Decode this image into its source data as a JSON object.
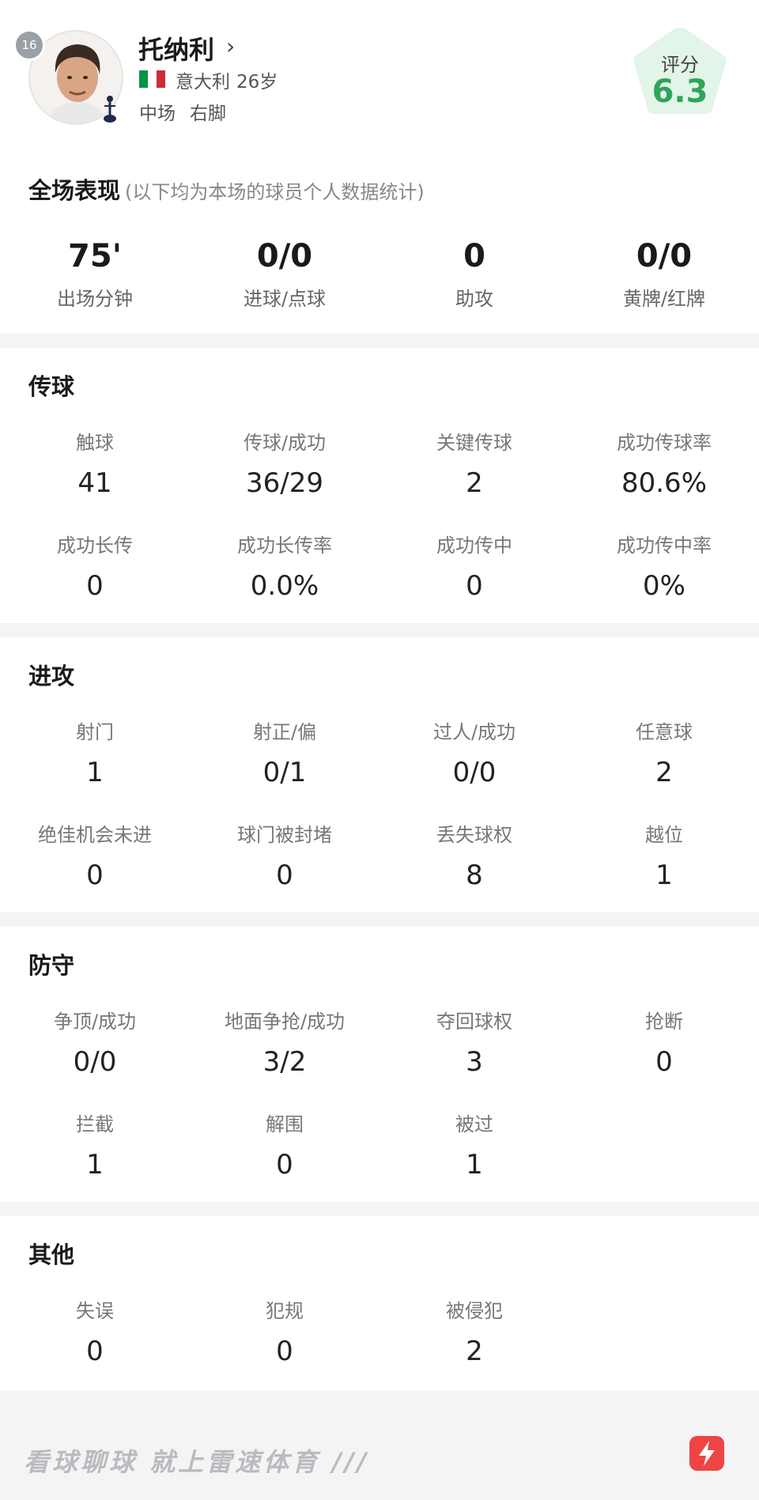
{
  "player": {
    "name": "托纳利",
    "jersey_number": "16",
    "nationality": "意大利",
    "age": "26岁",
    "position": "中场",
    "foot": "右脚",
    "rating_label": "评分",
    "rating": "6.3",
    "chevron": "›"
  },
  "overall": {
    "title": "全场表现",
    "note": "(以下均为本场的球员个人数据统计)",
    "stats": [
      {
        "value": "75'",
        "label": "出场分钟"
      },
      {
        "value": "0/0",
        "label": "进球/点球"
      },
      {
        "value": "0",
        "label": "助攻"
      },
      {
        "value": "0/0",
        "label": "黄牌/红牌"
      }
    ]
  },
  "sections": [
    {
      "title": "传球",
      "stats": [
        {
          "label": "触球",
          "value": "41"
        },
        {
          "label": "传球/成功",
          "value": "36/29"
        },
        {
          "label": "关键传球",
          "value": "2"
        },
        {
          "label": "成功传球率",
          "value": "80.6%"
        },
        {
          "label": "成功长传",
          "value": "0"
        },
        {
          "label": "成功长传率",
          "value": "0.0%"
        },
        {
          "label": "成功传中",
          "value": "0"
        },
        {
          "label": "成功传中率",
          "value": "0%"
        }
      ]
    },
    {
      "title": "进攻",
      "stats": [
        {
          "label": "射门",
          "value": "1"
        },
        {
          "label": "射正/偏",
          "value": "0/1"
        },
        {
          "label": "过人/成功",
          "value": "0/0"
        },
        {
          "label": "任意球",
          "value": "2"
        },
        {
          "label": "绝佳机会未进",
          "value": "0"
        },
        {
          "label": "球门被封堵",
          "value": "0"
        },
        {
          "label": "丢失球权",
          "value": "8"
        },
        {
          "label": "越位",
          "value": "1"
        }
      ]
    },
    {
      "title": "防守",
      "stats": [
        {
          "label": "争顶/成功",
          "value": "0/0"
        },
        {
          "label": "地面争抢/成功",
          "value": "3/2"
        },
        {
          "label": "夺回球权",
          "value": "3"
        },
        {
          "label": "抢断",
          "value": "0"
        },
        {
          "label": "拦截",
          "value": "1"
        },
        {
          "label": "解围",
          "value": "0"
        },
        {
          "label": "被过",
          "value": "1"
        }
      ]
    },
    {
      "title": "其他",
      "stats": [
        {
          "label": "失误",
          "value": "0"
        },
        {
          "label": "犯规",
          "value": "0"
        },
        {
          "label": "被侵犯",
          "value": "2"
        }
      ]
    }
  ],
  "footer": {
    "slogan": "看球聊球 就上雷速体育 ///",
    "logo_icon": "lightning-bolt-icon"
  },
  "colors": {
    "rating_green": "#2ea55a",
    "rating_bg": "#e3f4e8",
    "logo_red": "#ef4444",
    "flag_green": "#009246",
    "flag_white": "#ffffff",
    "flag_red": "#ce2b37"
  }
}
